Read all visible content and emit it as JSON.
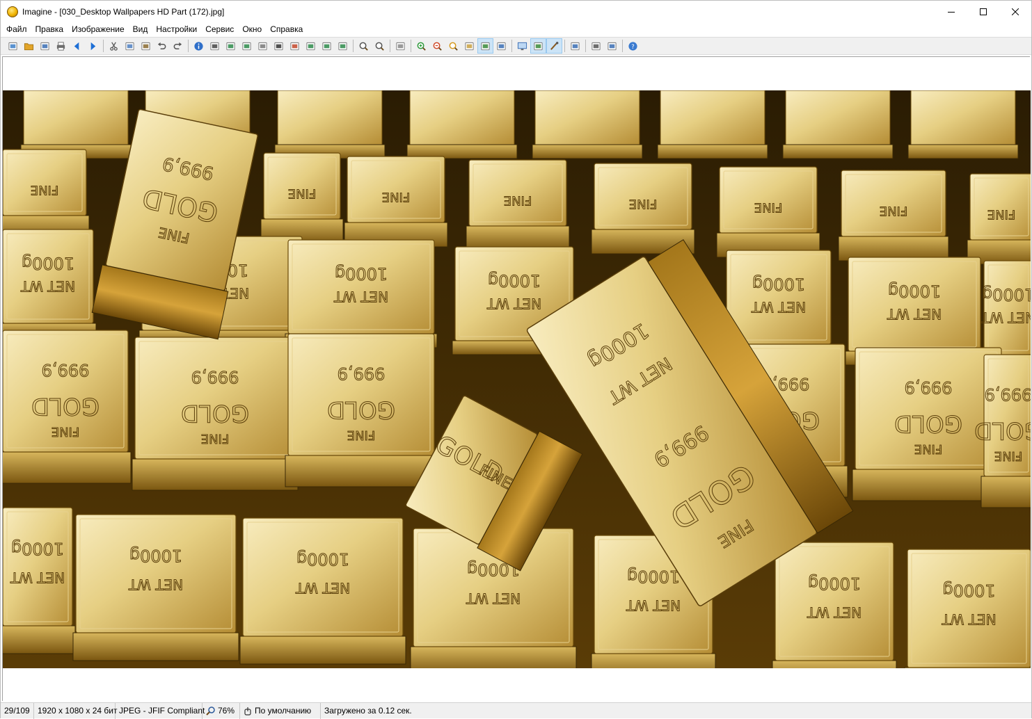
{
  "window": {
    "title": "Imagine - [030_Desktop Wallpapers  HD Part (172).jpg]",
    "app_icon": "imagine-app-icon"
  },
  "menu": [
    {
      "label": "Файл"
    },
    {
      "label": "Правка"
    },
    {
      "label": "Изображение"
    },
    {
      "label": "Вид"
    },
    {
      "label": "Настройки"
    },
    {
      "label": "Сервис"
    },
    {
      "label": "Окно"
    },
    {
      "label": "Справка"
    }
  ],
  "toolbar": {
    "groups": [
      [
        "new-icon",
        "open-icon",
        "save-all-icon",
        "print-icon",
        "prev-icon",
        "next-icon"
      ],
      [
        "cut-icon",
        "copy-icon",
        "paste-icon",
        "undo-icon",
        "redo-icon"
      ],
      [
        "info-icon",
        "capture-icon",
        "crop-icon",
        "resize-icon",
        "grayscale-icon",
        "negative-icon",
        "color-icon",
        "rotate-left-icon",
        "rotate-right-icon",
        "flip-icon"
      ],
      [
        "find-icon",
        "find-next-icon"
      ],
      [
        "slideshow-icon"
      ],
      [
        "zoom-in-icon",
        "zoom-out-icon",
        "zoom-reset-icon",
        "fit-window-icon",
        "fit-width-icon",
        "fit-height-icon"
      ],
      [
        "monitor-icon",
        "thumbnail-icon",
        "paint-icon"
      ],
      [
        "tools-icon"
      ],
      [
        "plugin-icon",
        "batch-icon"
      ],
      [
        "help-icon"
      ]
    ],
    "active": [
      "fit-width-icon",
      "thumbnail-icon",
      "paint-icon"
    ]
  },
  "image": {
    "description_colors": {
      "gold_light": "#f4e3a0",
      "gold_mid": "#c99a2e",
      "gold_dark": "#5a3d06",
      "shadow": "#1a1204"
    },
    "bar_labels": {
      "fine": "FINE",
      "gold": "GOLD",
      "purity": "999,9",
      "weight": "1000g",
      "net": "NET WT"
    }
  },
  "status": {
    "index": "29/109",
    "dimensions": "1920 x 1080 x 24 бит",
    "format": "JPEG - JFIF Compliant",
    "zoom": "76%",
    "profile": "По умолчанию",
    "load_time": "Загружено за 0.12 сек."
  }
}
